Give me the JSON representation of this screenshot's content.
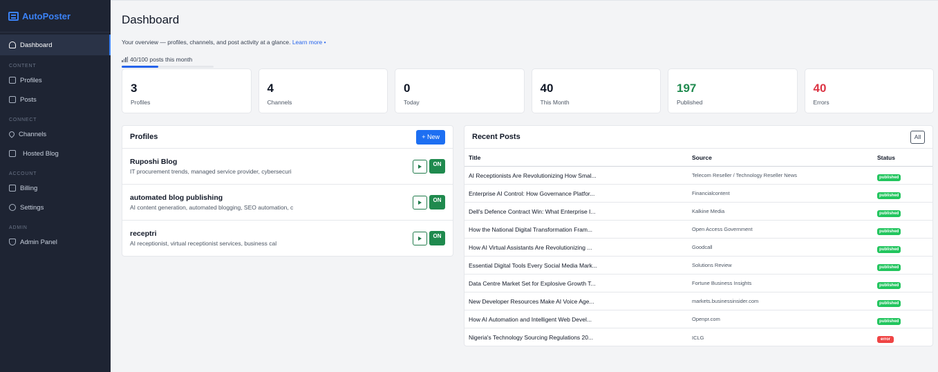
{
  "app": {
    "name": "AutoPoster"
  },
  "sidebar": {
    "dashboard": "Dashboard",
    "sections": {
      "content": "CONTENT",
      "connect": "CONNECT",
      "account": "ACCOUNT",
      "admin": "ADMIN"
    },
    "items": {
      "profiles": "Profiles",
      "posts": "Posts",
      "channels": "Channels",
      "hosted_blog": "Hosted Blog",
      "billing": "Billing",
      "settings": "Settings",
      "admin_panel": "Admin Panel"
    }
  },
  "header": {
    "title": "Dashboard",
    "overview": "Your overview — profiles, channels, and post activity at a glance.",
    "learn_more": "Learn more •",
    "usage_text": "40/100 posts this month",
    "usage_fraction": 0.4
  },
  "stats": [
    {
      "value": "3",
      "label": "Profiles",
      "color": "#111827"
    },
    {
      "value": "4",
      "label": "Channels",
      "color": "#111827"
    },
    {
      "value": "0",
      "label": "Today",
      "color": "#111827"
    },
    {
      "value": "40",
      "label": "This Month",
      "color": "#111827"
    },
    {
      "value": "197",
      "label": "Published",
      "color": "#1f8a4e"
    },
    {
      "value": "40",
      "label": "Errors",
      "color": "#dc3545"
    }
  ],
  "profiles": {
    "title": "Profiles",
    "new_label": "+ New",
    "toggle_label": "ON",
    "items": [
      {
        "name": "Ruposhi Blog",
        "desc": "IT procurement trends, managed service provider, cybersecuri"
      },
      {
        "name": "automated blog publishing",
        "desc": "AI content generation, automated blogging, SEO automation, c"
      },
      {
        "name": "receptri",
        "desc": "AI receptionist, virtual receptionist services, business cal"
      }
    ]
  },
  "recent_posts": {
    "title": "Recent Posts",
    "all_label": "All",
    "columns": {
      "title": "Title",
      "source": "Source",
      "status": "Status"
    },
    "rows": [
      {
        "title": "AI Receptionists Are Revolutionizing How Smal...",
        "source": "Telecom Reseller / Technology Reseller News",
        "status": "published"
      },
      {
        "title": "Enterprise AI Control: How Governance Platfor...",
        "source": "Financialcontent",
        "status": "published"
      },
      {
        "title": "Dell's Defence Contract Win: What Enterprise I...",
        "source": "Kalkine Media",
        "status": "published"
      },
      {
        "title": "How the National Digital Transformation Fram...",
        "source": "Open Access Government",
        "status": "published"
      },
      {
        "title": "How AI Virtual Assistants Are Revolutionizing ...",
        "source": "Goodcall",
        "status": "published"
      },
      {
        "title": "Essential Digital Tools Every Social Media Mark...",
        "source": "Solutions Review",
        "status": "published"
      },
      {
        "title": "Data Centre Market Set for Explosive Growth T...",
        "source": "Fortune Business Insights",
        "status": "published"
      },
      {
        "title": "New Developer Resources Make AI Voice Age...",
        "source": "markets.businessinsider.com",
        "status": "published"
      },
      {
        "title": "How AI Automation and Intelligent Web Devel...",
        "source": "Openpr.com",
        "status": "published"
      },
      {
        "title": "Nigeria's Technology Sourcing Regulations 20...",
        "source": "ICLG",
        "status": "error"
      }
    ]
  }
}
